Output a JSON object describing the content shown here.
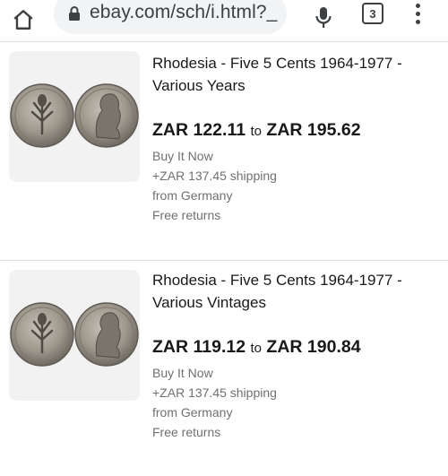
{
  "browser": {
    "url": "ebay.com/sch/i.html?_",
    "tab_count": "3"
  },
  "listings": [
    {
      "title": "Rhodesia - Five 5 Cents 1964-1977 - Various Years",
      "price_low": "ZAR 122.11",
      "price_sep": "to",
      "price_high": "ZAR 195.62",
      "format": "Buy It Now",
      "shipping": "+ZAR 137.45 shipping",
      "location": "from Germany",
      "returns": "Free returns"
    },
    {
      "title": "Rhodesia - Five 5 Cents 1964-1977 - Various Vintages",
      "price_low": "ZAR 119.12",
      "price_sep": "to",
      "price_high": "ZAR 190.84",
      "format": "Buy It Now",
      "shipping": "+ZAR 137.45 shipping",
      "location": "from Germany",
      "returns": "Free returns"
    }
  ],
  "icons": {
    "home": "home-icon",
    "lock": "lock-icon",
    "mic": "microphone-icon",
    "tabs": "tab-switcher-icon",
    "menu": "more-vert-icon"
  },
  "colors": {
    "text": "#191919",
    "muted": "#707070",
    "urlbar": "#f1f3f4",
    "thumb_bg": "#f2f2f2"
  }
}
